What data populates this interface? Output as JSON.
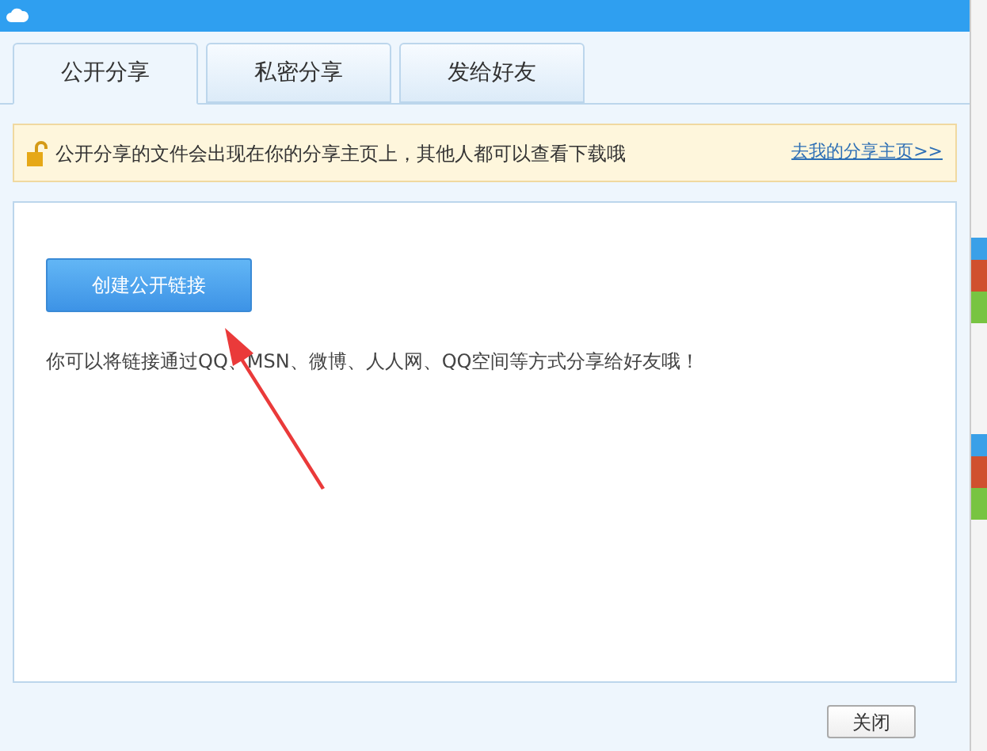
{
  "tabs": [
    {
      "label": "公开分享",
      "selected": true
    },
    {
      "label": "私密分享",
      "selected": false
    },
    {
      "label": "发给好友",
      "selected": false
    }
  ],
  "notice": {
    "text": "公开分享的文件会出现在你的分享主页上，其他人都可以查看下载哦",
    "link": "去我的分享主页>>"
  },
  "panel": {
    "button": "创建公开链接",
    "hint": "你可以将链接通过QQ、MSN、微博、人人网、QQ空间等方式分享给好友哦！"
  },
  "buttons": [
    "关闭"
  ]
}
